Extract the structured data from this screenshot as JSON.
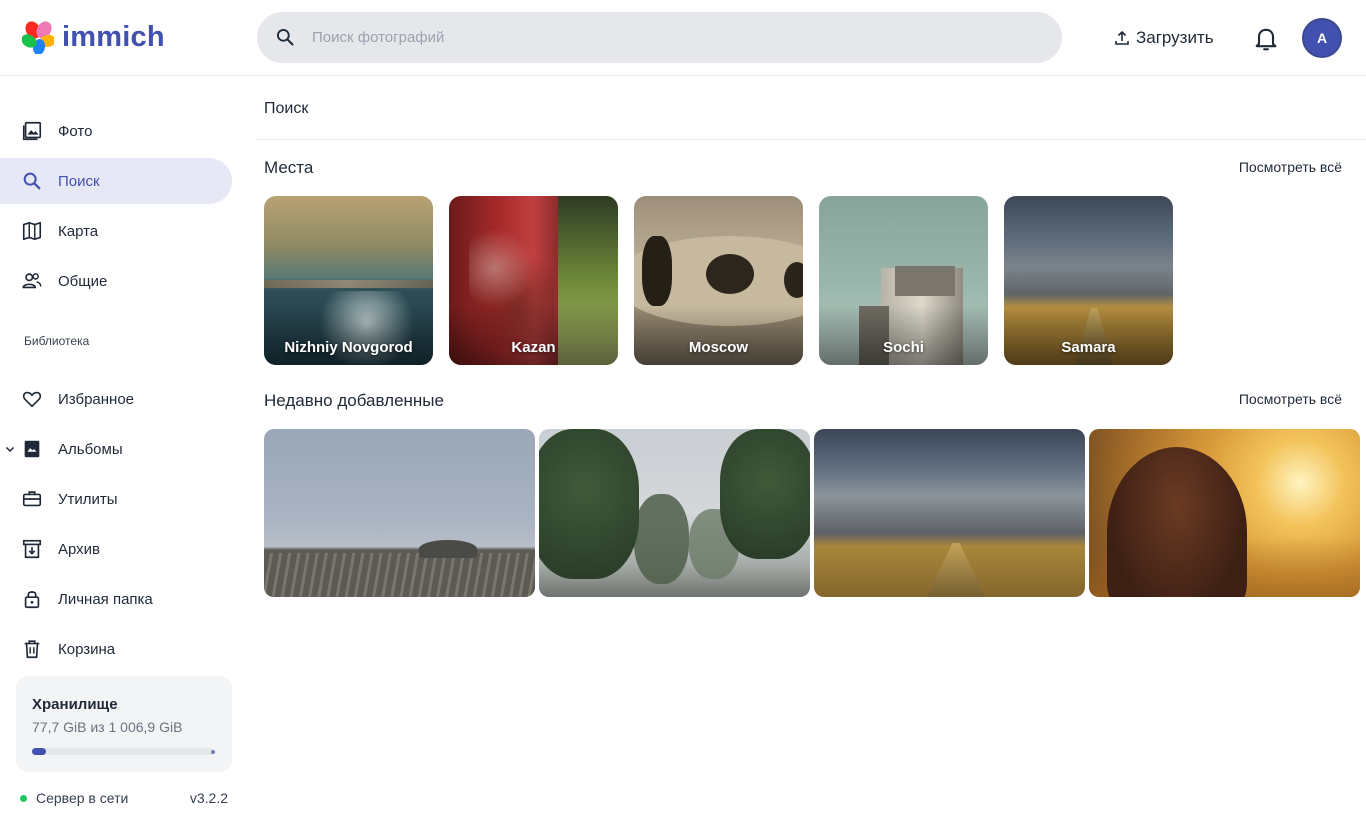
{
  "app": {
    "name": "immich",
    "colors": {
      "brand": "#4250af",
      "active_bg": "#e6e8f5",
      "online": "#22c55e"
    }
  },
  "header": {
    "search_placeholder": "Поиск фотографий",
    "upload_label": "Загрузить",
    "avatar_initial": "A"
  },
  "sidebar": {
    "items": [
      {
        "label": "Фото",
        "icon": "photos-icon"
      },
      {
        "label": "Поиск",
        "icon": "search-icon",
        "active": true
      },
      {
        "label": "Карта",
        "icon": "map-icon"
      },
      {
        "label": "Общие",
        "icon": "people-icon"
      }
    ],
    "library_label": "Библиотека",
    "library_items": [
      {
        "label": "Избранное",
        "icon": "heart-icon"
      },
      {
        "label": "Альбомы",
        "icon": "album-icon"
      },
      {
        "label": "Утилиты",
        "icon": "toolbox-icon"
      },
      {
        "label": "Архив",
        "icon": "archive-icon"
      },
      {
        "label": "Личная папка",
        "icon": "lock-icon"
      },
      {
        "label": "Корзина",
        "icon": "trash-icon"
      }
    ],
    "storage": {
      "title": "Хранилище",
      "usage": "77,7 GiB из 1 006,9 GiB",
      "used_fraction": 0.077
    },
    "server": {
      "status": "Сервер в сети",
      "version": "v3.2.2"
    }
  },
  "main": {
    "page_title": "Поиск",
    "places": {
      "heading": "Места",
      "view_all": "Посмотреть всё",
      "items": [
        {
          "name": "Nizhniy Novgorod"
        },
        {
          "name": "Kazan"
        },
        {
          "name": "Moscow"
        },
        {
          "name": "Sochi"
        },
        {
          "name": "Samara"
        }
      ]
    },
    "recent": {
      "heading": "Недавно добавленные",
      "view_all": "Посмотреть всё"
    }
  }
}
